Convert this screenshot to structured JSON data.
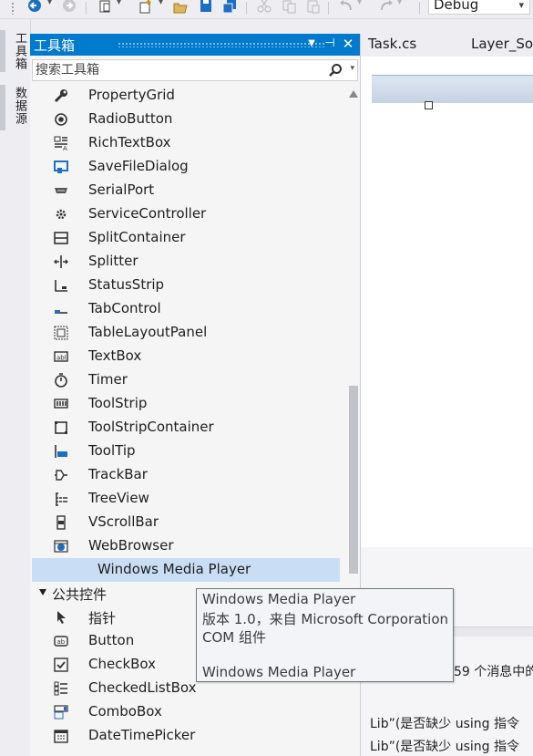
{
  "toolbar": {
    "configuration": "Debug",
    "icons": [
      "back-icon",
      "forward-icon",
      "new-project-icon",
      "add-item-icon",
      "open-icon",
      "save-icon",
      "save-all-icon",
      "cut-icon",
      "copy-icon",
      "paste-icon",
      "undo-icon",
      "redo-icon"
    ]
  },
  "side_tabs": [
    "工具箱",
    "数据源"
  ],
  "toolbox": {
    "title": "工具箱",
    "search_placeholder": "搜索工具箱",
    "items": [
      {
        "label": "PropertyGrid",
        "icon": "property-grid-icon"
      },
      {
        "label": "RadioButton",
        "icon": "radio-button-icon"
      },
      {
        "label": "RichTextBox",
        "icon": "rich-textbox-icon"
      },
      {
        "label": "SaveFileDialog",
        "icon": "save-file-dialog-icon"
      },
      {
        "label": "SerialPort",
        "icon": "serial-port-icon"
      },
      {
        "label": "ServiceController",
        "icon": "service-controller-icon"
      },
      {
        "label": "SplitContainer",
        "icon": "split-container-icon"
      },
      {
        "label": "Splitter",
        "icon": "splitter-icon"
      },
      {
        "label": "StatusStrip",
        "icon": "status-strip-icon"
      },
      {
        "label": "TabControl",
        "icon": "tab-control-icon"
      },
      {
        "label": "TableLayoutPanel",
        "icon": "table-layout-panel-icon"
      },
      {
        "label": "TextBox",
        "icon": "textbox-icon"
      },
      {
        "label": "Timer",
        "icon": "timer-icon"
      },
      {
        "label": "ToolStrip",
        "icon": "tool-strip-icon"
      },
      {
        "label": "ToolStripContainer",
        "icon": "tool-strip-container-icon"
      },
      {
        "label": "ToolTip",
        "icon": "tooltip-icon"
      },
      {
        "label": "TrackBar",
        "icon": "trackbar-icon"
      },
      {
        "label": "TreeView",
        "icon": "treeview-icon"
      },
      {
        "label": "VScrollBar",
        "icon": "vscrollbar-icon"
      },
      {
        "label": "WebBrowser",
        "icon": "web-browser-icon"
      },
      {
        "label": "Windows Media Player",
        "icon": "",
        "selected": true
      }
    ],
    "group_label": "公共控件",
    "common_items": [
      {
        "label": "指针",
        "icon": "pointer-icon"
      },
      {
        "label": "Button",
        "icon": "button-icon"
      },
      {
        "label": "CheckBox",
        "icon": "checkbox-icon"
      },
      {
        "label": "CheckedListBox",
        "icon": "checked-listbox-icon"
      },
      {
        "label": "ComboBox",
        "icon": "combobox-icon"
      },
      {
        "label": "DateTimePicker",
        "icon": "datetime-picker-icon"
      }
    ]
  },
  "editor": {
    "tabs": [
      "Task.cs",
      "Layer_Sor"
    ],
    "output_lines": [
      "59 个消息中的",
      "Lib”(是否缺少 using 指令",
      "Lib”(是否缺少 using 指令"
    ]
  },
  "tooltip": {
    "line1": "Windows Media Player",
    "line2": "版本 1.0，来自 Microsoft Corporation",
    "line3": "COM 组件",
    "line4": "Windows Media Player"
  },
  "colors": {
    "accent": "#007acc",
    "selection": "#c9def5",
    "panel": "#f5f5f5"
  }
}
